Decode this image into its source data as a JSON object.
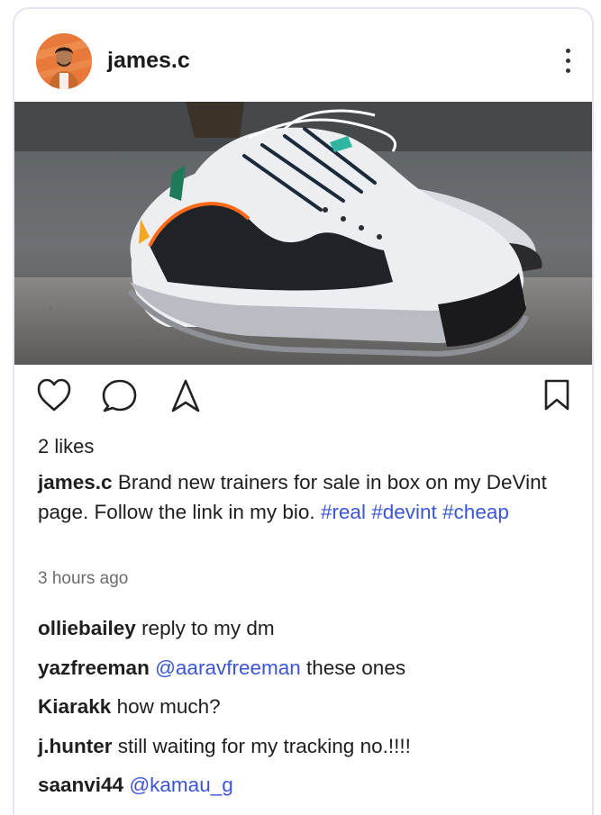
{
  "post": {
    "author": "james.c",
    "avatar_icon": "user-avatar",
    "image_alt_icon": "sneaker-photo",
    "likes": "2 likes",
    "caption": {
      "author": "james.c",
      "text": " Brand new trainers for sale in box on my DeVint page. Follow the link in my bio. ",
      "hashtags": [
        "#real",
        "#devint",
        "#cheap"
      ]
    },
    "timestamp": "3 hours ago"
  },
  "actions": {
    "like_icon": "heart-icon",
    "comment_icon": "comment-icon",
    "share_icon": "send-icon",
    "save_icon": "bookmark-icon"
  },
  "comments": [
    {
      "user": "olliebailey",
      "mention": "",
      "text": " reply to my dm"
    },
    {
      "user": "yazfreeman",
      "mention": " @aaravfreeman",
      "text": " these ones"
    },
    {
      "user": "Kiarakk",
      "mention": "",
      "text": " how much?"
    },
    {
      "user": "j.hunter",
      "mention": "",
      "text": " still waiting for my tracking no.!!!!"
    },
    {
      "user": "saanvi44",
      "mention": " @kamau_g",
      "text": ""
    }
  ],
  "colors": {
    "link": "#3b55d6",
    "card_border": "#e7e3f4",
    "avatar_bg": "#e8793a"
  }
}
